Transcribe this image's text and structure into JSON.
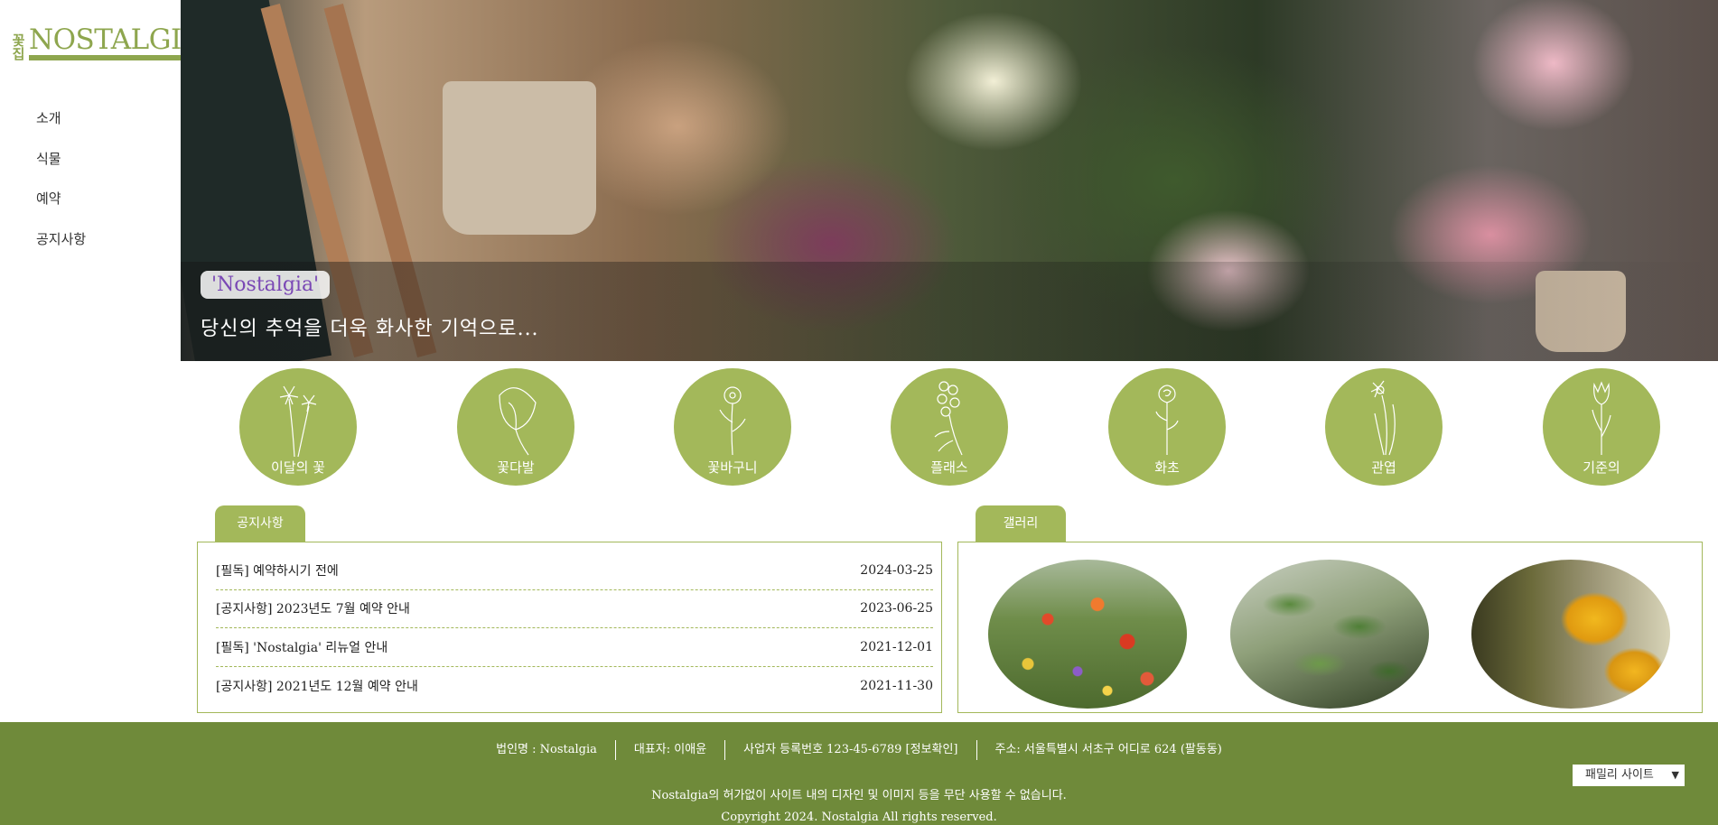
{
  "logo": {
    "hanja": "꽃집",
    "name": "NOSTALGIA"
  },
  "nav": [
    {
      "label": "소개"
    },
    {
      "label": "식물"
    },
    {
      "label": "예약"
    },
    {
      "label": "공지사항"
    }
  ],
  "hero": {
    "badge": "'Nostalgia'",
    "subtitle": "당신의 추억을 더욱 화사한 기억으로..."
  },
  "categories": [
    {
      "label": "이달의 꽃",
      "icon": "lily-icon"
    },
    {
      "label": "꽃다발",
      "icon": "calla-icon"
    },
    {
      "label": "꽃바구니",
      "icon": "poppy-icon"
    },
    {
      "label": "플래스",
      "icon": "larkspur-icon"
    },
    {
      "label": "화초",
      "icon": "rose-icon"
    },
    {
      "label": "관엽",
      "icon": "daffodil-icon"
    },
    {
      "label": "기준의",
      "icon": "tulip-icon"
    }
  ],
  "notice": {
    "tab_label": "공지사항",
    "rows": [
      {
        "title": "[필독] 예약하시기 전에",
        "date": "2024-03-25"
      },
      {
        "title": "[공지사항] 2023년도 7월 예약 안내",
        "date": "2023-06-25"
      },
      {
        "title": "[필독] 'Nostalgia' 리뉴얼 안내",
        "date": "2021-12-01"
      },
      {
        "title": "[공지사항] 2021년도 12월 예약 안내",
        "date": "2021-11-30"
      }
    ]
  },
  "gallery": {
    "tab_label": "갤러리"
  },
  "footer": {
    "company": "법인명 : Nostalgia",
    "ceo": "대표자: 이애윤",
    "biz_no": "사업자 등록번호 123-45-6789 [정보확인]",
    "address": "주소: 서울특별시 서초구 어디로 624 (팔동동)",
    "notice": "Nostalgia의 허가없이 사이트 내의 디자인 및 이미지 등을 무단 사용할 수 없습니다.",
    "copyright": "Copyright 2024. Nostalgia All rights reserved.",
    "family_site": "패밀리 사이트"
  },
  "colors": {
    "accent": "#a3b85a",
    "footer": "#6f8a3a",
    "badge_text": "#7a48b5"
  }
}
